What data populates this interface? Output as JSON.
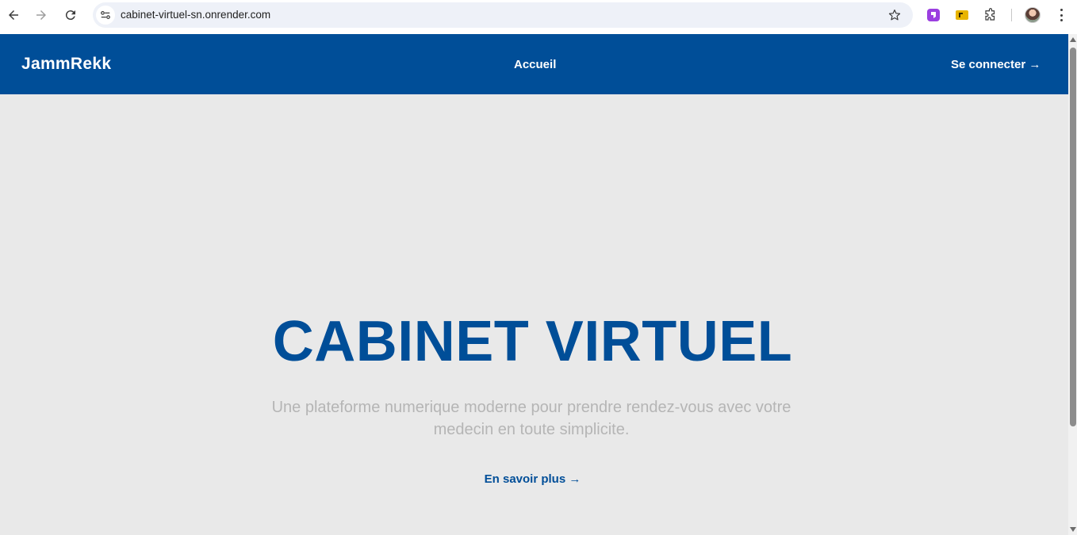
{
  "browser": {
    "url": "cabinet-virtuel-sn.onrender.com",
    "icons": [
      "back-icon",
      "forward-icon",
      "reload-icon",
      "site-info-icon",
      "bookmark-star-icon",
      "extension-purple-icon",
      "extension-yellow-icon",
      "extensions-puzzle-icon",
      "profile-avatar",
      "menu-kebab-icon"
    ]
  },
  "header": {
    "brand": "JammRekk",
    "nav_home": "Accueil",
    "login": "Se connecter →"
  },
  "hero": {
    "title": "CABINET VIRTUEL",
    "subtitle": "Une plateforme numerique moderne pour prendre rendez-vous avec votre medecin en toute simplicite.",
    "cta": "En savoir plus →"
  },
  "colors": {
    "brand_blue": "#004e98",
    "page_bg": "#e9e9e9",
    "subtitle_gray": "#b5b5b5"
  }
}
